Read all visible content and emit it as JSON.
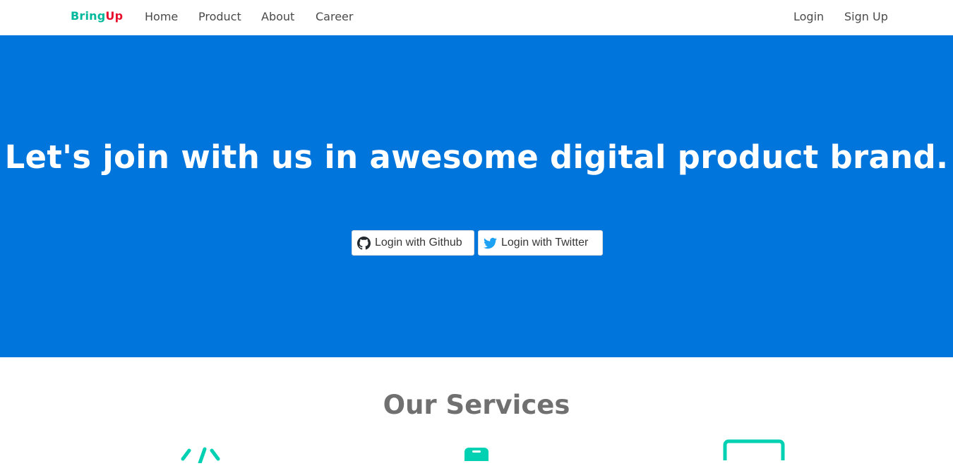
{
  "nav": {
    "brand_part1": "Bring",
    "brand_part2": "Up",
    "links": [
      "Home",
      "Product",
      "About",
      "Career"
    ],
    "login": "Login",
    "signup": "Sign Up"
  },
  "hero": {
    "title": "Let's join with us in awesome digital product brand.",
    "github_button": "Login with Github",
    "twitter_button": "Login with Twitter",
    "github_icon": "github-icon",
    "twitter_icon": "twitter-icon"
  },
  "services": {
    "title": "Our Services",
    "icons": [
      "code-icon",
      "mobile-icon",
      "desktop-icon"
    ]
  },
  "colors": {
    "brand_green": "#00b89c",
    "brand_red": "#e8112d",
    "hero_blue": "#0075db",
    "icon_teal": "#00d1b2",
    "twitter_blue": "#1da1f2"
  }
}
